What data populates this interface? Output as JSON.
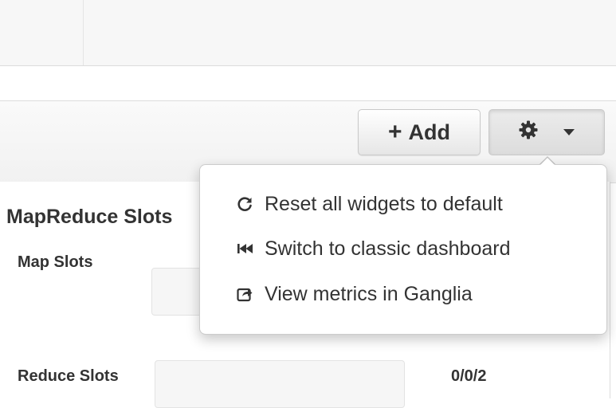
{
  "toolbar": {
    "add_label": "Add",
    "add_icon": "plus-icon",
    "settings_icon": "gear-icon",
    "settings_caret": "chevron-down-icon"
  },
  "dropdown": {
    "items": [
      {
        "label": "Reset all widgets to default",
        "icon": "refresh-icon"
      },
      {
        "label": "Switch to classic dashboard",
        "icon": "backward-icon"
      },
      {
        "label": "View metrics in Ganglia",
        "icon": "external-link-icon"
      }
    ]
  },
  "widget": {
    "title": "MapReduce Slots",
    "rows": [
      {
        "label": "Map Slots",
        "value": ""
      },
      {
        "label": "Reduce Slots",
        "value": "0/0/2"
      }
    ]
  }
}
